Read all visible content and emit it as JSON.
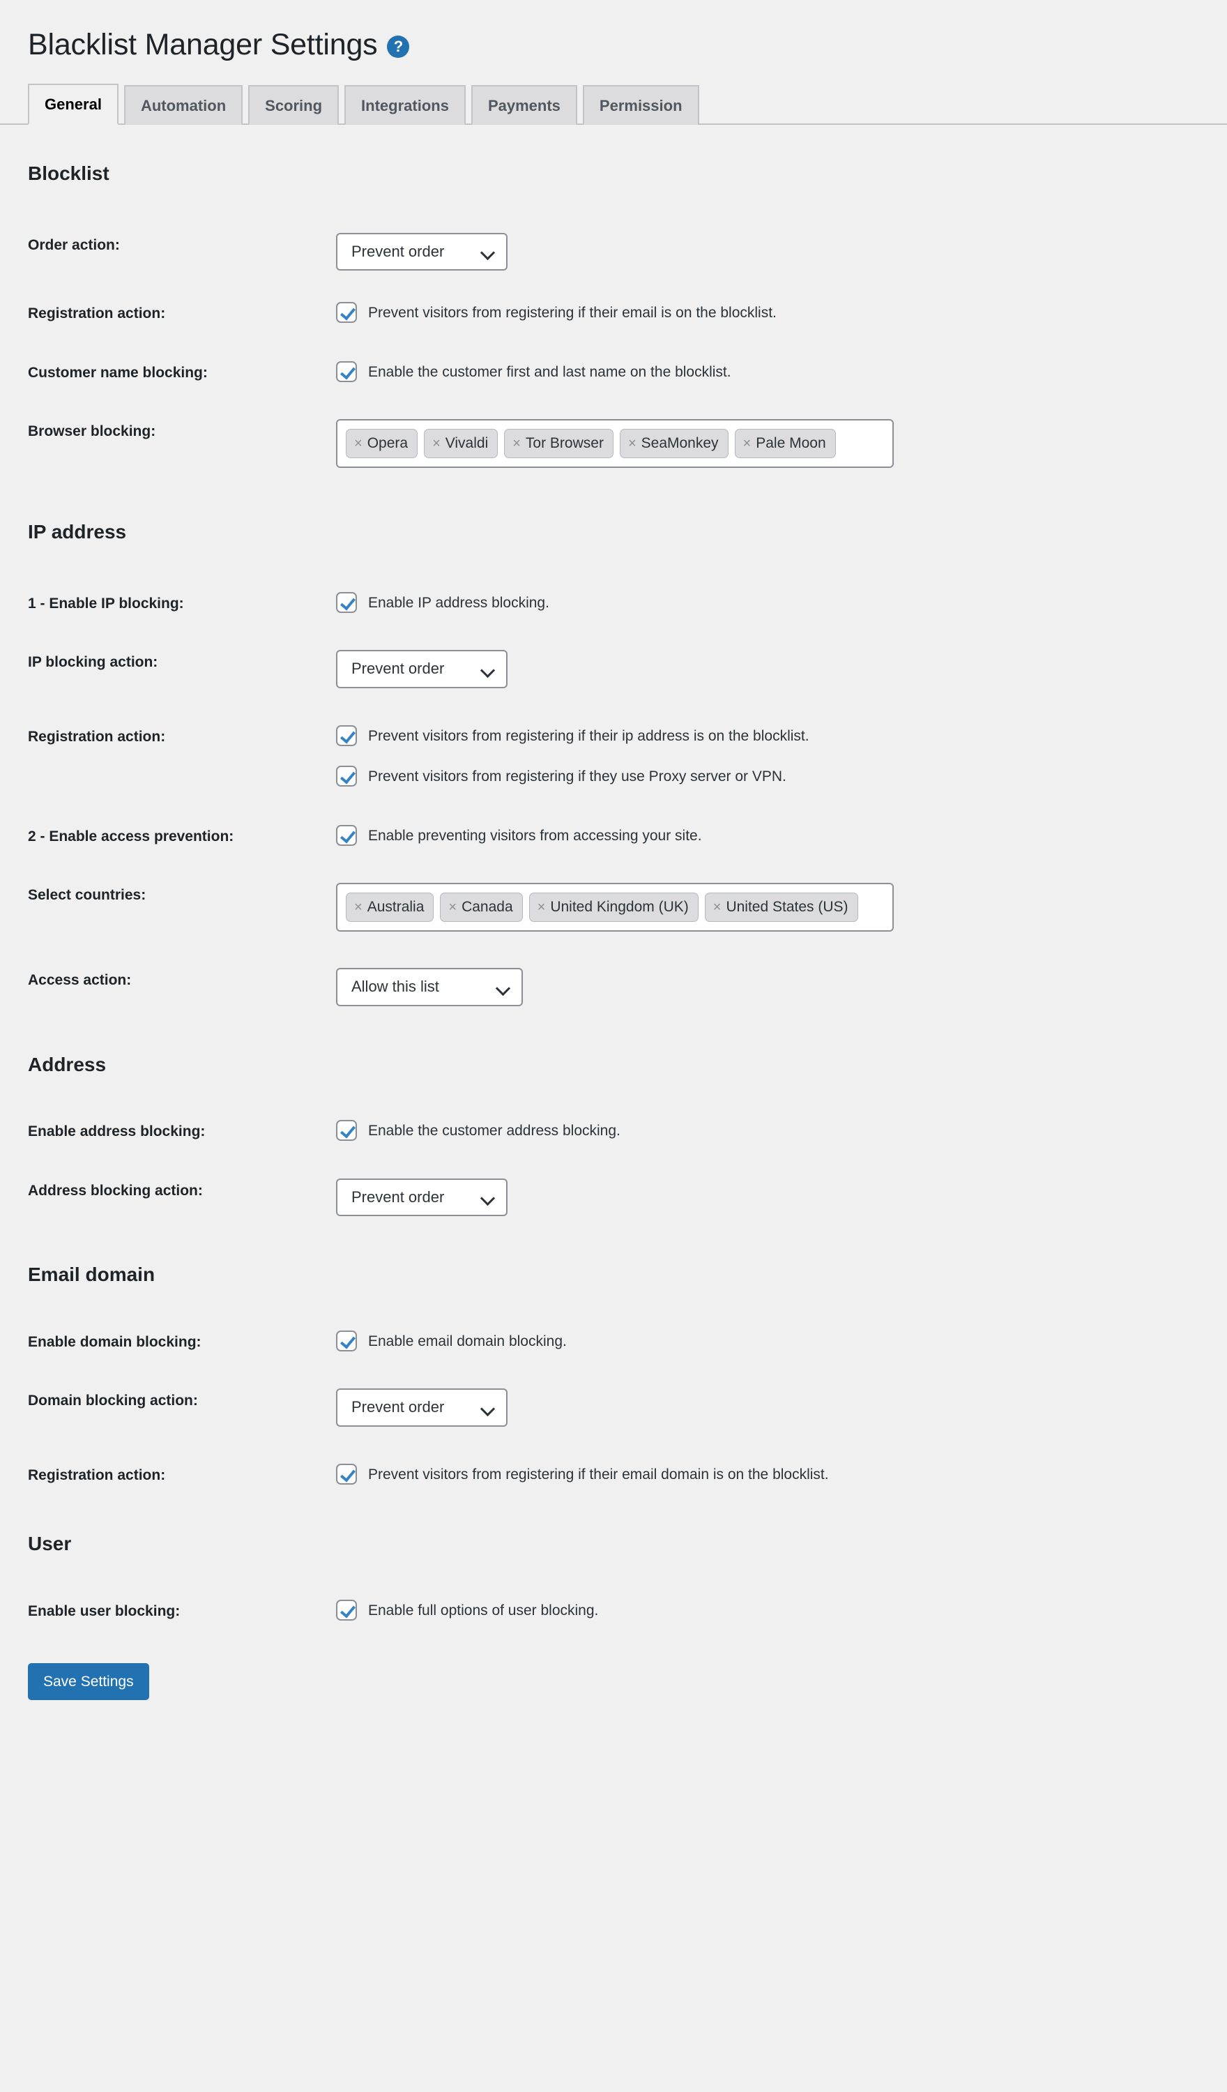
{
  "header": {
    "title": "Blacklist Manager Settings",
    "help_icon": "help-circle-icon",
    "help_glyph": "?"
  },
  "tabs": [
    {
      "label": "General",
      "active": true
    },
    {
      "label": "Automation",
      "active": false
    },
    {
      "label": "Scoring",
      "active": false
    },
    {
      "label": "Integrations",
      "active": false
    },
    {
      "label": "Payments",
      "active": false
    },
    {
      "label": "Permission",
      "active": false
    }
  ],
  "sections": {
    "blocklist": {
      "heading": "Blocklist",
      "order_action": {
        "label": "Order action:",
        "value": "Prevent order"
      },
      "registration_action": {
        "label": "Registration action:",
        "checkbox_text": "Prevent visitors from registering if their email is on the blocklist."
      },
      "customer_name_blocking": {
        "label": "Customer name blocking:",
        "checkbox_text": "Enable the customer first and last name on the blocklist."
      },
      "browser_blocking": {
        "label": "Browser blocking:",
        "tags": [
          "Opera",
          "Vivaldi",
          "Tor Browser",
          "SeaMonkey",
          "Pale Moon"
        ]
      }
    },
    "ip_address": {
      "heading": "IP address",
      "enable_ip_blocking": {
        "label": "1 - Enable IP blocking:",
        "checkbox_text": "Enable IP address blocking."
      },
      "ip_blocking_action": {
        "label": "IP blocking action:",
        "value": "Prevent order"
      },
      "registration_action": {
        "label": "Registration action:",
        "checkbox_text_1": "Prevent visitors from registering if their ip address is on the blocklist.",
        "checkbox_text_2": "Prevent visitors from registering if they use Proxy server or VPN."
      },
      "enable_access_prevention": {
        "label": "2 - Enable access prevention:",
        "checkbox_text": "Enable preventing visitors from accessing your site."
      },
      "select_countries": {
        "label": "Select countries:",
        "tags": [
          "Australia",
          "Canada",
          "United Kingdom (UK)",
          "United States (US)"
        ]
      },
      "access_action": {
        "label": "Access action:",
        "value": "Allow this list"
      }
    },
    "address": {
      "heading": "Address",
      "enable_address_blocking": {
        "label": "Enable address blocking:",
        "checkbox_text": "Enable the customer address blocking."
      },
      "address_blocking_action": {
        "label": "Address blocking action:",
        "value": "Prevent order"
      }
    },
    "email_domain": {
      "heading": "Email domain",
      "enable_domain_blocking": {
        "label": "Enable domain blocking:",
        "checkbox_text": "Enable email domain blocking."
      },
      "domain_blocking_action": {
        "label": "Domain blocking action:",
        "value": "Prevent order"
      },
      "registration_action": {
        "label": "Registration action:",
        "checkbox_text": "Prevent visitors from registering if their email domain is on the blocklist."
      }
    },
    "user": {
      "heading": "User",
      "enable_user_blocking": {
        "label": "Enable user blocking:",
        "checkbox_text": "Enable full options of user blocking."
      }
    }
  },
  "footer": {
    "save_label": "Save Settings"
  },
  "colors": {
    "accent": "#2271b1",
    "check": "#3582c4",
    "page_bg": "#f0f0f1",
    "tab_inactive": "#dcdcde",
    "border": "#8c8f94"
  }
}
